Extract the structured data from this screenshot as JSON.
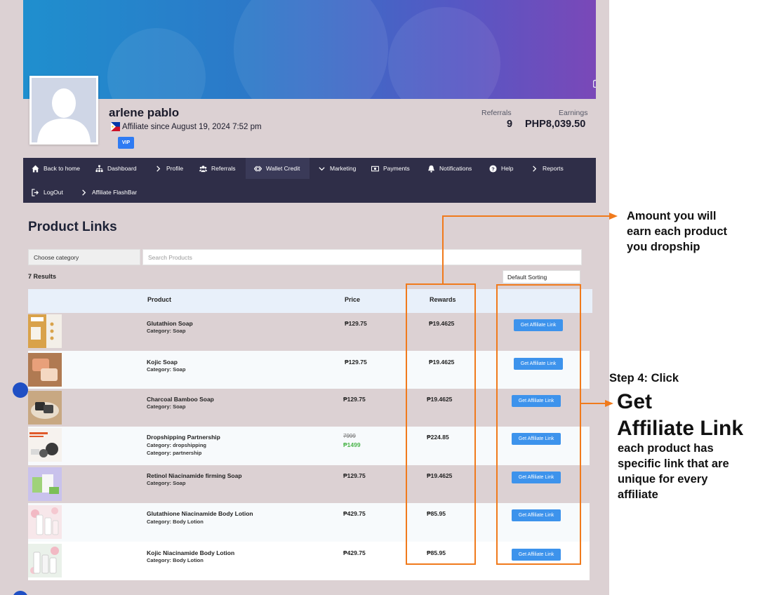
{
  "profile": {
    "name": "arlene pablo",
    "since": "Affiliate since August 19, 2024 7:52 pm",
    "badge": "VIP",
    "referrals_label": "Referrals",
    "referrals_value": "9",
    "earnings_label": "Earnings",
    "earnings_value": "PHP8,039.50"
  },
  "nav": {
    "items": [
      {
        "label": "Back to home",
        "icon": "home-icon"
      },
      {
        "label": "Dashboard",
        "icon": "dashboard-icon"
      },
      {
        "label": "Profile",
        "icon": "chevron-right-icon"
      },
      {
        "label": "Referrals",
        "icon": "users-icon"
      },
      {
        "label": "Wallet Credit",
        "icon": "wallet-icon"
      },
      {
        "label": "Marketing",
        "icon": "chevron-down-icon"
      },
      {
        "label": "Payments",
        "icon": "money-icon"
      },
      {
        "label": "Notifications",
        "icon": "bell-icon"
      },
      {
        "label": "Help",
        "icon": "help-icon"
      },
      {
        "label": "Reports",
        "icon": "chevron-right-icon"
      },
      {
        "label": "LogOut",
        "icon": "logout-icon"
      },
      {
        "label": "Affiliate FlashBar",
        "icon": "chevron-right-icon"
      }
    ]
  },
  "products": {
    "title": "Product Links",
    "category_placeholder": "Choose category",
    "search_placeholder": "Search Products",
    "results": "7 Results",
    "sort": "Default Sorting",
    "columns": {
      "product": "Product",
      "price": "Price",
      "rewards": "Rewards"
    },
    "button_label": "Get Affiliate Link",
    "rows": [
      {
        "name": "Glutathion Soap",
        "cats": [
          "Category: Soap"
        ],
        "price": "₱129.75",
        "reward": "₱19.4625"
      },
      {
        "name": "Kojic Soap",
        "cats": [
          "Category: Soap"
        ],
        "price": "₱129.75",
        "reward": "₱19.4625"
      },
      {
        "name": "Charcoal Bamboo Soap",
        "cats": [
          "Category: Soap"
        ],
        "price": "₱129.75",
        "reward": "₱19.4625"
      },
      {
        "name": "Dropshipping Partnership",
        "cats": [
          "Category: dropshipping",
          "Category: partnership"
        ],
        "price_old": "7999",
        "price": "₱1499",
        "reward": "₱224.85"
      },
      {
        "name": "Retinol Niacinamide firming Soap",
        "cats": [
          "Category: Soap"
        ],
        "price": "₱129.75",
        "reward": "₱19.4625"
      },
      {
        "name": "Glutathione Niacinamide Body Lotion",
        "cats": [
          "Category: Body Lotion"
        ],
        "price": "₱429.75",
        "reward": "₱85.95"
      },
      {
        "name": "Kojic Niacinamide Body Lotion",
        "cats": [
          "Category: Body Lotion"
        ],
        "price": "₱429.75",
        "reward": "₱85.95"
      }
    ]
  },
  "annotations": {
    "rewards_note": [
      "Amount you will",
      "earn each product",
      "you dropship"
    ],
    "step_label": "Step 4: Click",
    "step_big": [
      "Get",
      "Affiliate Link"
    ],
    "step_desc": [
      "each product has",
      "specific link that are",
      "unique for every",
      "affiliate"
    ]
  },
  "colors": {
    "accent": "#f07a1c",
    "nav_bg": "#2f2e48",
    "button": "#3d93ec",
    "page_bg": "#dcd1d3"
  }
}
